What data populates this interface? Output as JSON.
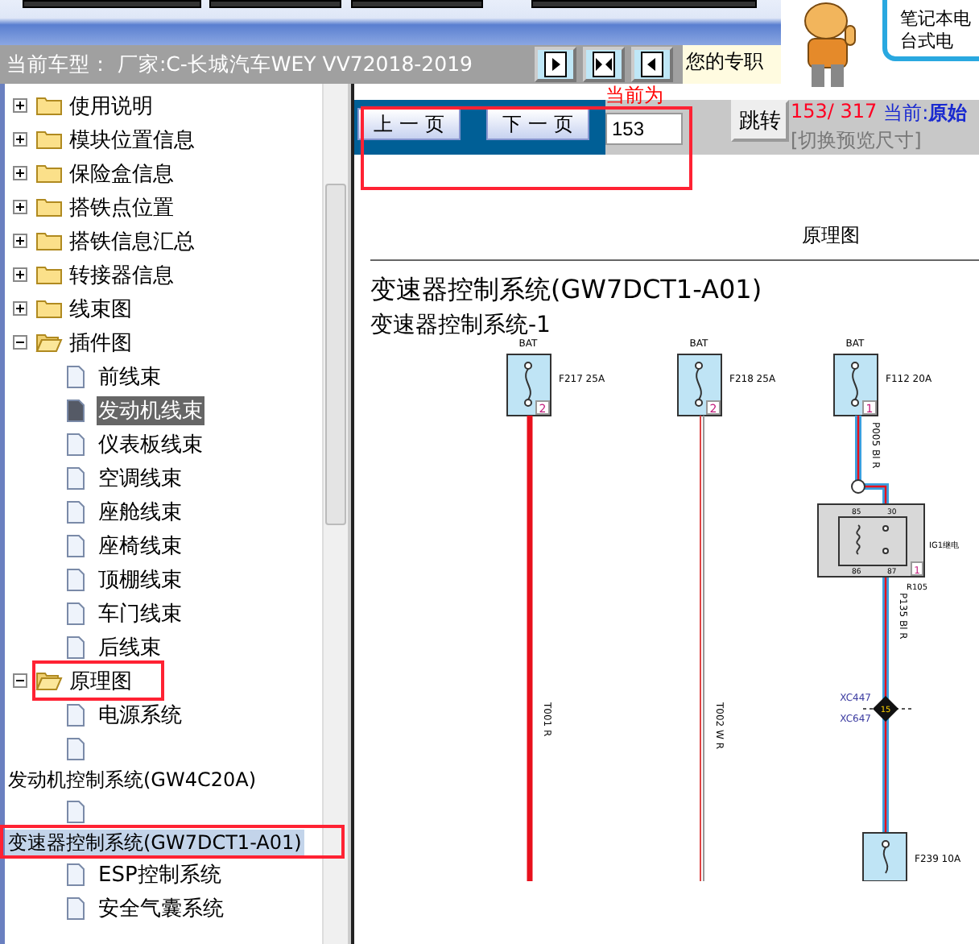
{
  "header": {
    "vehicle": "当前车型： 厂家:C-长城汽车WEY VV72018-2019",
    "notice": "您的专职",
    "bubble_lines": [
      "笔记本电",
      "台式电"
    ]
  },
  "view_buttons": [
    {
      "kind": "right"
    },
    {
      "kind": "both"
    },
    {
      "kind": "left"
    }
  ],
  "tree": {
    "items": [
      {
        "kind": "folder",
        "label": "使用说明",
        "expanded": false
      },
      {
        "kind": "folder",
        "label": "模块位置信息",
        "expanded": false
      },
      {
        "kind": "folder",
        "label": "保险盒信息",
        "expanded": false
      },
      {
        "kind": "folder",
        "label": "搭铁点位置",
        "expanded": false
      },
      {
        "kind": "folder",
        "label": "搭铁信息汇总",
        "expanded": false
      },
      {
        "kind": "folder",
        "label": "转接器信息",
        "expanded": false
      },
      {
        "kind": "folder",
        "label": "线束图",
        "expanded": false
      },
      {
        "kind": "folder",
        "label": "插件图",
        "expanded": true,
        "children": [
          {
            "kind": "doc",
            "label": "前线束",
            "selected": false,
            "highlighted": false
          },
          {
            "kind": "doc",
            "label": "发动机线束",
            "selected": true,
            "highlighted": false
          },
          {
            "kind": "doc",
            "label": "仪表板线束",
            "selected": false,
            "highlighted": false
          },
          {
            "kind": "doc",
            "label": "空调线束",
            "selected": false,
            "highlighted": false
          },
          {
            "kind": "doc",
            "label": "座舱线束",
            "selected": false,
            "highlighted": false
          },
          {
            "kind": "doc",
            "label": "座椅线束",
            "selected": false,
            "highlighted": false
          },
          {
            "kind": "doc",
            "label": "顶棚线束",
            "selected": false,
            "highlighted": false
          },
          {
            "kind": "doc",
            "label": "车门线束",
            "selected": false,
            "highlighted": false
          },
          {
            "kind": "doc",
            "label": "后线束",
            "selected": false,
            "highlighted": false
          }
        ]
      },
      {
        "kind": "folder",
        "label": "原理图",
        "expanded": true,
        "children": [
          {
            "kind": "doc",
            "label": "电源系统",
            "selected": false,
            "highlighted": false
          },
          {
            "kind": "doc-wrapped",
            "label": "发动机控制系统(GW4C20A)",
            "selected": false,
            "highlighted": false
          },
          {
            "kind": "doc-wrapped",
            "label": "变速器控制系统(GW7DCT1-A01)",
            "selected": false,
            "highlighted": true
          },
          {
            "kind": "doc",
            "label": "ESP控制系统",
            "selected": false,
            "highlighted": false
          },
          {
            "kind": "doc",
            "label": "安全气囊系统",
            "selected": false,
            "highlighted": false
          }
        ]
      }
    ]
  },
  "pager": {
    "prev": "上 一 页",
    "next": "下 一 页",
    "current_label": "当前为",
    "page_value": "153",
    "jump": "跳转",
    "count": "153/ 317",
    "current_prefix": "当前:",
    "current_name": "原始",
    "resize": "[切换预览尺寸]"
  },
  "document": {
    "section": "原理图",
    "title": "变速器控制系统(GW7DCT1-A01)",
    "subtitle": "变速器控制系统-1",
    "diagram": {
      "fuses": [
        {
          "source": "BAT",
          "name": "F217 25A",
          "pin": "2",
          "wire": "T001 R"
        },
        {
          "source": "BAT",
          "name": "F218 25A",
          "pin": "2",
          "wire": "T002 W R"
        },
        {
          "source": "BAT",
          "name": "F112 20A",
          "pin": "1",
          "wire": "P005 Bl R"
        }
      ],
      "relay": {
        "name": "IG1继电",
        "ref": "R105",
        "pin": "1",
        "terminals": [
          "85",
          "30",
          "86",
          "87"
        ]
      },
      "relay_wire": "P135 Bl R",
      "connectors": [
        "XC447",
        "XC647"
      ],
      "connector_pin": "15",
      "bottom_fuse": "F239 10A"
    }
  }
}
